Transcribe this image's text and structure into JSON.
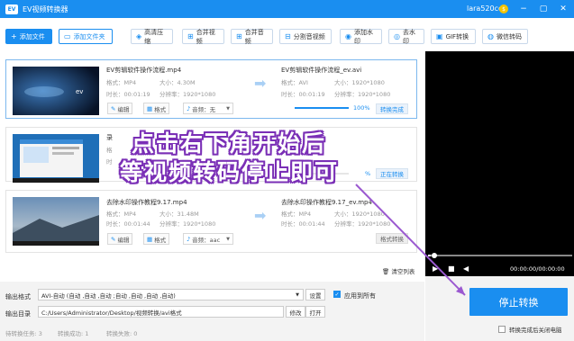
{
  "window": {
    "logo": "EV",
    "title": "EV视频转换器",
    "user": "lara520cc",
    "coin": "$",
    "controls": [
      "−",
      "▢",
      "✕"
    ]
  },
  "toolbar": {
    "add_file": "添加文件",
    "add_folder": "添加文件夹",
    "items": [
      "高清压缩",
      "合并视频",
      "合并音频",
      "分割音视频",
      "添加水印",
      "去水印",
      "GIF转换",
      "微信转码"
    ]
  },
  "files": [
    {
      "src_name": "EV剪辑软件操作流程.mp4",
      "src_format": "格式：MP4",
      "src_size": "大小：4.30M",
      "src_duration": "时长：00:01:19",
      "src_resolution": "分辨率：1920*1080",
      "dst_name": "EV剪辑软件操作流程_ev.avi",
      "dst_format": "格式：AVI",
      "dst_size": "大小：1920*1080",
      "dst_duration": "时长：00:01:19",
      "dst_resolution": "分辨率：1920*1080",
      "edit": "编辑",
      "format": "格式",
      "audio": "音频：无",
      "progress_pct": "100%",
      "progress": 1.0,
      "status": "转换完成"
    },
    {
      "src_name": "录",
      "src_format": "格",
      "src_size": "",
      "src_duration": "时",
      "src_resolution": "",
      "dst_name": "",
      "edit": "",
      "format": "",
      "audio": "",
      "progress_pct": "%",
      "progress": 0.3,
      "status": "正在转换"
    },
    {
      "src_name": "去除水印操作教程9.17.mp4",
      "src_format": "格式：MP4",
      "src_size": "大小：31.48M",
      "src_duration": "时长：00:01:44",
      "src_resolution": "分辨率：1920*1080",
      "dst_name": "去除水印操作教程9.17_ev.mp4",
      "dst_format": "格式：MP4",
      "dst_size": "大小：1920*1080",
      "dst_duration": "时长：00:01:44",
      "dst_resolution": "分辨率：1920*1080",
      "edit": "编辑",
      "format": "格式",
      "audio": "音频：aac",
      "status": "格式转换"
    }
  ],
  "clear_list": "清空列表",
  "footer": {
    "output_format_label": "输出格式",
    "output_format_value": "AVI-自动 (自动 ,自动 ,自动 ;自动 ,自动 ,自动 ,自动)",
    "settings": "设置",
    "apply_all": "应用到所有",
    "output_dir_label": "输出目录",
    "output_dir_value": "C:/Users/Administrator/Desktop/视频转换/avi格式",
    "modify": "修改",
    "open": "打开",
    "pending": "待转换任务: 3",
    "success": "转换成功: 1",
    "failed": "转换失败: 0"
  },
  "player": {
    "time": "00:00:00/00:00:00"
  },
  "action": {
    "stop": "停止转换",
    "shutdown": "转换完成后关闭电脑"
  },
  "annotation": {
    "line1": "点击右下角开始后",
    "line2": "等视频转码停止即可"
  }
}
